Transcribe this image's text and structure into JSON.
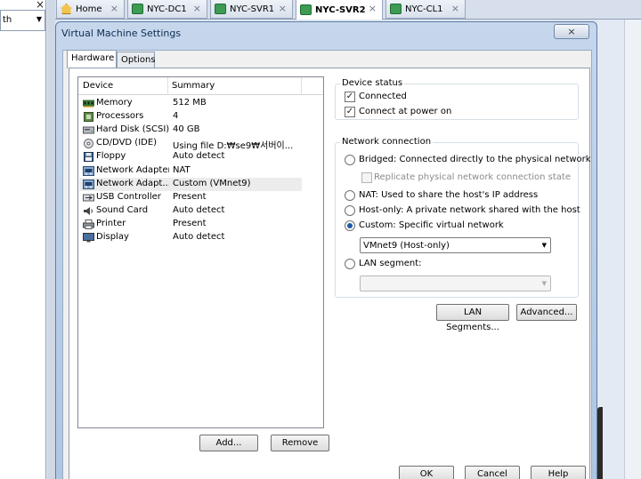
{
  "left_panel": {
    "close_glyph": "×",
    "combo_text": "th",
    "combo_arrow": "▼"
  },
  "tabs": [
    {
      "label": "Home",
      "icon": "home-icon",
      "close": "×",
      "active": false
    },
    {
      "label": "NYC-DC1",
      "icon": "vm-icon",
      "close": "×",
      "active": false
    },
    {
      "label": "NYC-SVR1",
      "icon": "vm-icon",
      "close": "×",
      "active": false
    },
    {
      "label": "NYC-SVR2",
      "icon": "vm-icon",
      "close": "×",
      "active": true
    },
    {
      "label": "NYC-CL1",
      "icon": "vm-icon",
      "close": "×",
      "active": false
    }
  ],
  "dialog": {
    "title": "Virtual Machine Settings",
    "close_glyph": "×",
    "tabs": [
      "Hardware",
      "Options"
    ],
    "active_tab": "Hardware"
  },
  "device_list": {
    "col_device": "Device",
    "col_summary": "Summary",
    "devices": [
      {
        "name": "Memory",
        "summary": "512 MB",
        "icon": "memory-icon",
        "selected": false
      },
      {
        "name": "Processors",
        "summary": "4",
        "icon": "processor-icon",
        "selected": false
      },
      {
        "name": "Hard Disk (SCSI)",
        "summary": "40 GB",
        "icon": "hard-disk-icon",
        "selected": false
      },
      {
        "name": "CD/DVD (IDE)",
        "summary": "Using file D:₩se9₩서버이...",
        "icon": "cd-dvd-icon",
        "selected": false
      },
      {
        "name": "Floppy",
        "summary": "Auto detect",
        "icon": "floppy-icon",
        "selected": false
      },
      {
        "name": "Network Adapter",
        "summary": "NAT",
        "icon": "network-adapter-icon",
        "selected": false
      },
      {
        "name": "Network Adapt...",
        "summary": "Custom (VMnet9)",
        "icon": "network-adapter-icon",
        "selected": true
      },
      {
        "name": "USB Controller",
        "summary": "Present",
        "icon": "usb-icon",
        "selected": false
      },
      {
        "name": "Sound Card",
        "summary": "Auto detect",
        "icon": "sound-icon",
        "selected": false
      },
      {
        "name": "Printer",
        "summary": "Present",
        "icon": "printer-icon",
        "selected": false
      },
      {
        "name": "Display",
        "summary": "Auto detect",
        "icon": "display-icon",
        "selected": false
      }
    ],
    "add_button": "Add...",
    "remove_button": "Remove"
  },
  "device_status": {
    "label": "Device status",
    "connected": {
      "label": "Connected",
      "checked": true
    },
    "connect_at_power_on": {
      "label": "Connect at power on",
      "checked": true
    }
  },
  "network_connection": {
    "label": "Network connection",
    "bridged": {
      "label": "Bridged: Connected directly to the physical network",
      "checked": false
    },
    "replicate": {
      "label": "Replicate physical network connection state",
      "checked": false,
      "enabled": false
    },
    "nat": {
      "label": "NAT: Used to share the host's IP address",
      "checked": false
    },
    "host_only": {
      "label": "Host-only: A private network shared with the host",
      "checked": false
    },
    "custom": {
      "label": "Custom: Specific virtual network",
      "checked": true
    },
    "custom_select": {
      "value": "VMnet9 (Host-only)",
      "arrow": "▼"
    },
    "lan_segment": {
      "label": "LAN segment:",
      "checked": false
    },
    "lan_select": {
      "value": "",
      "arrow": "▼"
    }
  },
  "buttons": {
    "lan_segments": "LAN Segments...",
    "advanced": "Advanced...",
    "ok": "OK",
    "cancel": "Cancel",
    "help": "Help"
  }
}
